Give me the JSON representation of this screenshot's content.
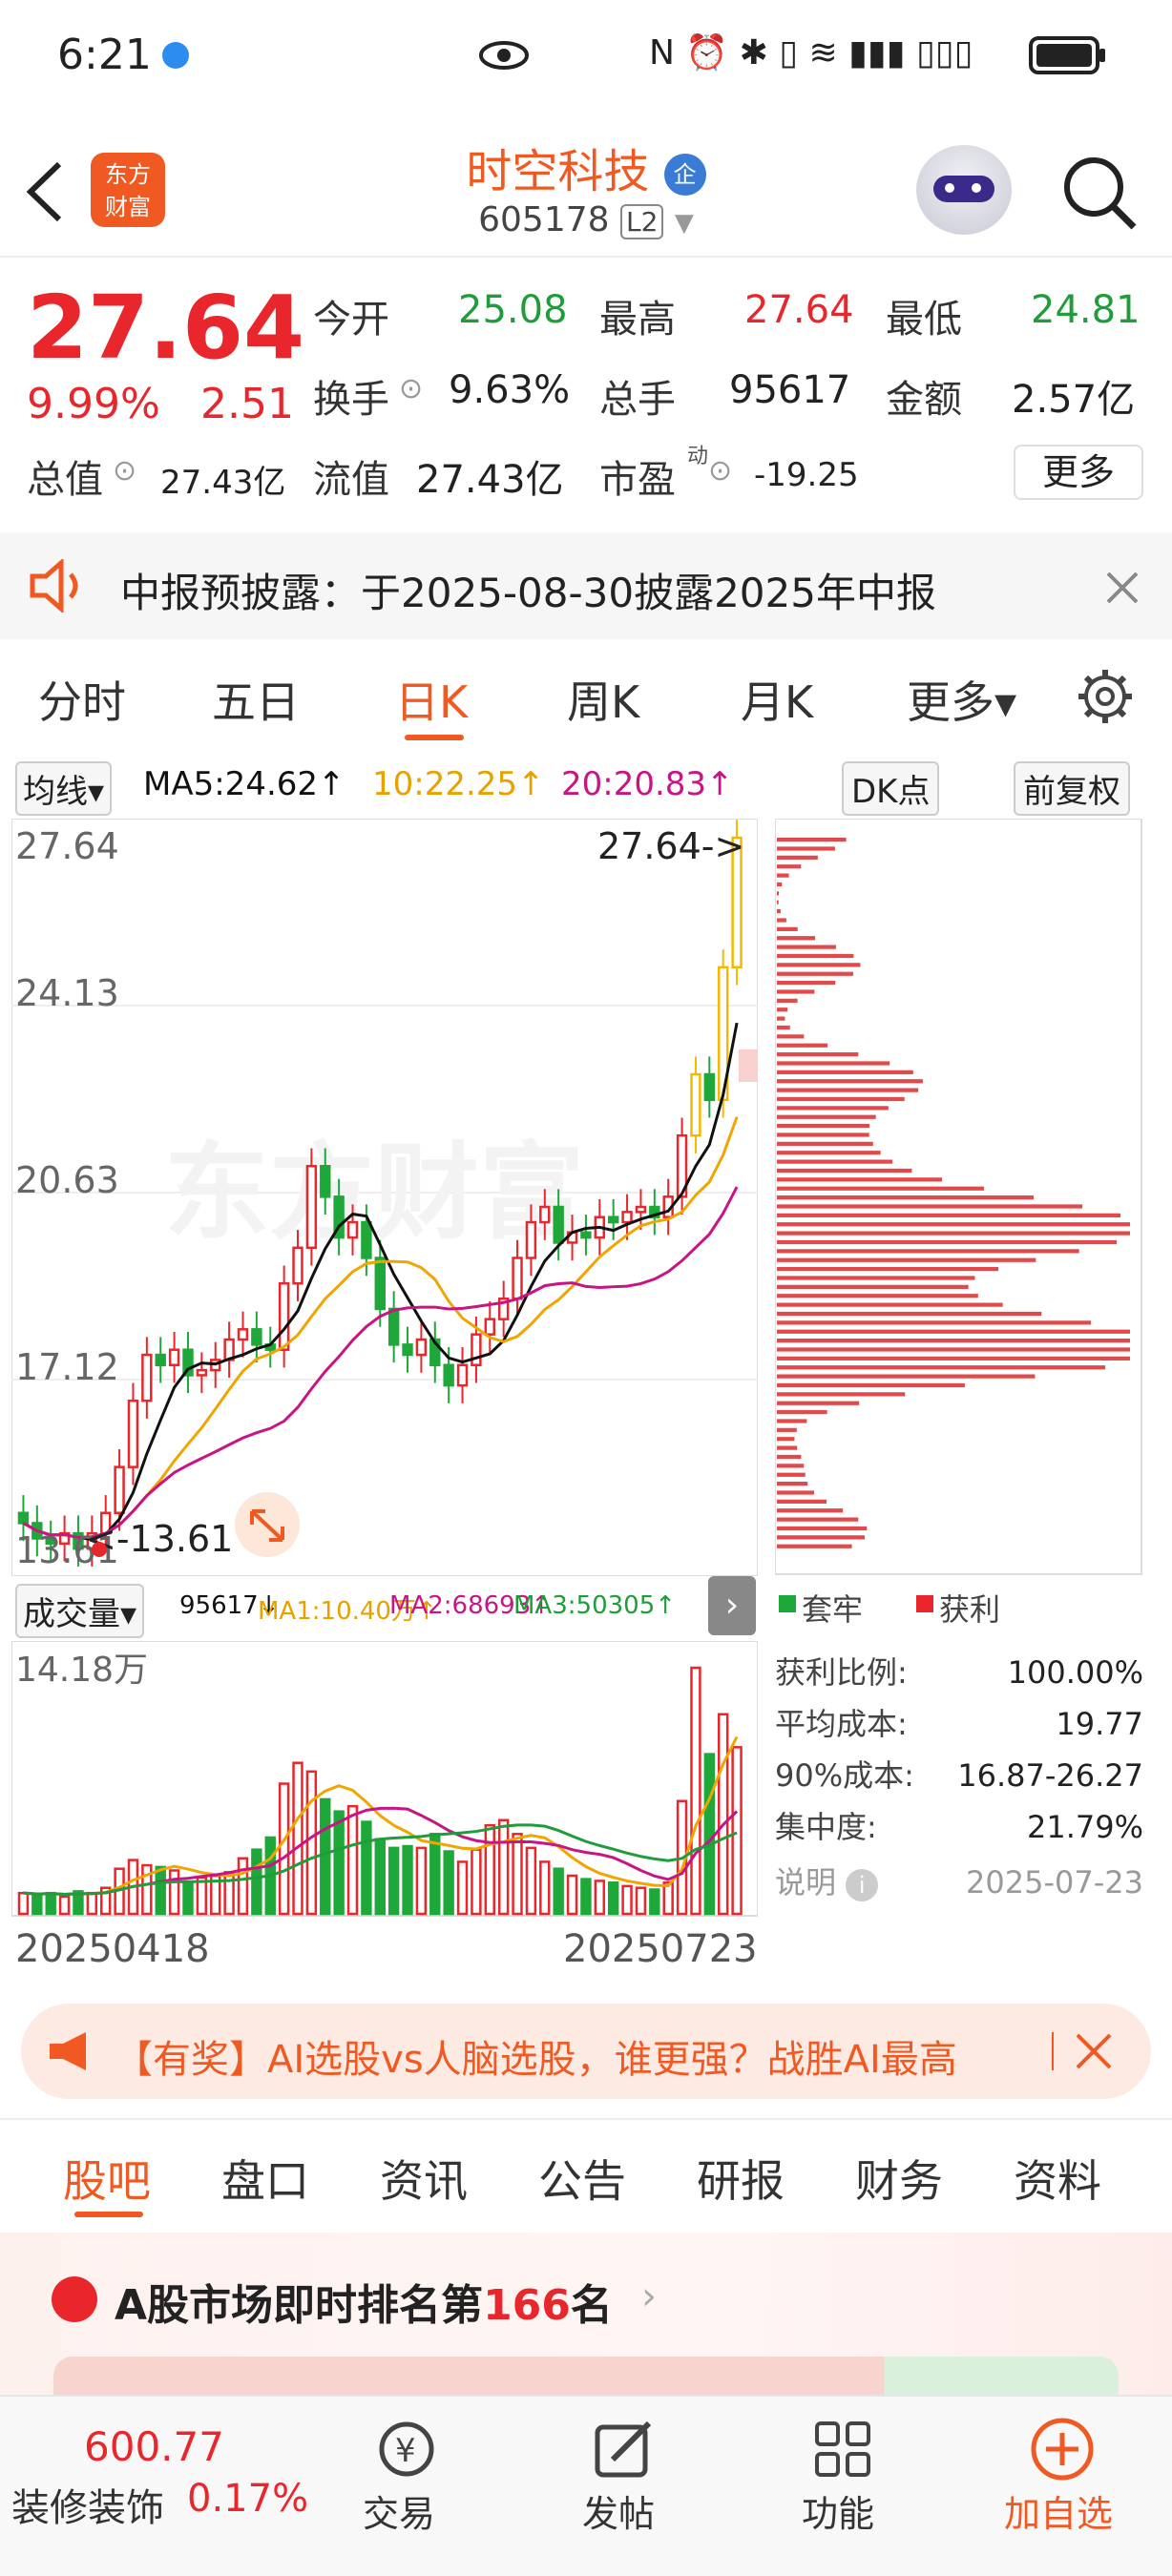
{
  "status": {
    "time": "6:21"
  },
  "header": {
    "brand_line1": "东方",
    "brand_line2": "财富",
    "stock_name": "时空科技",
    "badge": "企",
    "code": "605178",
    "level": "L2"
  },
  "quote": {
    "price": "27.64",
    "change_pct": "9.99%",
    "change": "2.51",
    "open_label": "今开",
    "open": "25.08",
    "high_label": "最高",
    "high": "27.64",
    "low_label": "最低",
    "low": "24.81",
    "turnover_label": "换手",
    "turnover": "9.63%",
    "volume_label": "总手",
    "volume": "95617",
    "amount_label": "金额",
    "amount": "2.57亿",
    "mktcap_label": "总值",
    "mktcap": "27.43亿",
    "float_label": "流值",
    "float": "27.43亿",
    "pe_label": "市盈",
    "pe_sup": "动",
    "pe": "-19.25",
    "more": "更多"
  },
  "notice": {
    "text": "中报预披露：于2025-08-30披露2025年中报"
  },
  "ktabs": [
    "分时",
    "五日",
    "日K",
    "周K",
    "月K",
    "更多▾"
  ],
  "ma": {
    "dropdown": "均线▾",
    "ma5": "MA5:24.62↑",
    "ma10": "10:22.25↑",
    "ma20": "20:20.83↑",
    "dk": "DK点",
    "adjust": "前复权"
  },
  "axis": {
    "y": [
      "27.64",
      "24.13",
      "20.63",
      "17.12",
      "13.61"
    ],
    "hi_mark": "27.64->",
    "lo_mark": "<-13.61",
    "vol_max": "14.18万",
    "date_start": "20250418",
    "date_end": "20250723"
  },
  "vol": {
    "dropdown": "成交量▾",
    "v": "95617↓",
    "ma1": "MA1:10.40万↑",
    "ma2": "MA2:68693↑",
    "ma3": "MA3:50305↑"
  },
  "chips": {
    "legend_trap": "套牢",
    "legend_profit": "获利",
    "profit_ratio_label": "获利比例:",
    "profit_ratio": "100.00%",
    "avg_cost_label": "平均成本:",
    "avg_cost": "19.77",
    "cost90_label": "90%成本:",
    "cost90": "16.87-26.27",
    "conc_label": "集中度:",
    "conc": "21.79%",
    "note": "说明",
    "date": "2025-07-23"
  },
  "banner": {
    "text": "【有奖】AI选股vs人脑选股，谁更强？战胜AI最高"
  },
  "subtabs": [
    "股吧",
    "盘口",
    "资讯",
    "公告",
    "研报",
    "财务",
    "资料"
  ],
  "ranking": {
    "prefix": "A股市场即时排名第",
    "num": "166",
    "suffix": "名"
  },
  "nav": {
    "index_value": "600.77",
    "index_name": "装修装饰",
    "index_pct": "0.17%",
    "trade": "交易",
    "post": "发帖",
    "func": "功能",
    "add": "加自选"
  },
  "watermark": "东方财富",
  "chart_data": {
    "type": "candlestick",
    "ylim": [
      13.61,
      27.64
    ],
    "x_range": [
      "20250418",
      "20250723"
    ],
    "close": [
      14.2,
      13.9,
      13.8,
      14.0,
      13.7,
      14.0,
      14.4,
      15.3,
      16.6,
      17.5,
      17.3,
      17.6,
      17.1,
      17.2,
      17.4,
      17.8,
      18.0,
      17.7,
      17.6,
      18.9,
      19.6,
      21.2,
      20.6,
      19.8,
      20.1,
      19.4,
      18.4,
      17.7,
      17.5,
      17.8,
      17.3,
      16.9,
      17.3,
      17.9,
      18.2,
      18.6,
      19.4,
      20.1,
      20.4,
      19.7,
      19.9,
      19.8,
      20.2,
      20.1,
      20.3,
      20.4,
      20.2,
      20.6,
      21.8,
      23.0,
      22.5,
      25.1,
      27.64
    ],
    "volume": [
      1.2,
      1.1,
      1.2,
      1.0,
      1.3,
      1.2,
      1.5,
      2.6,
      3.1,
      2.8,
      2.7,
      2.5,
      1.8,
      2.1,
      2.2,
      2.4,
      3.2,
      3.7,
      4.4,
      7.5,
      8.7,
      8.2,
      6.6,
      5.9,
      6.2,
      5.3,
      4.3,
      3.8,
      3.9,
      3.8,
      4.6,
      3.6,
      3.0,
      3.7,
      5.1,
      5.4,
      4.6,
      3.8,
      3.0,
      2.6,
      2.2,
      2.0,
      1.9,
      1.8,
      1.6,
      1.5,
      1.4,
      1.8,
      6.5,
      14.18,
      9.2,
      11.5,
      9.6
    ]
  }
}
